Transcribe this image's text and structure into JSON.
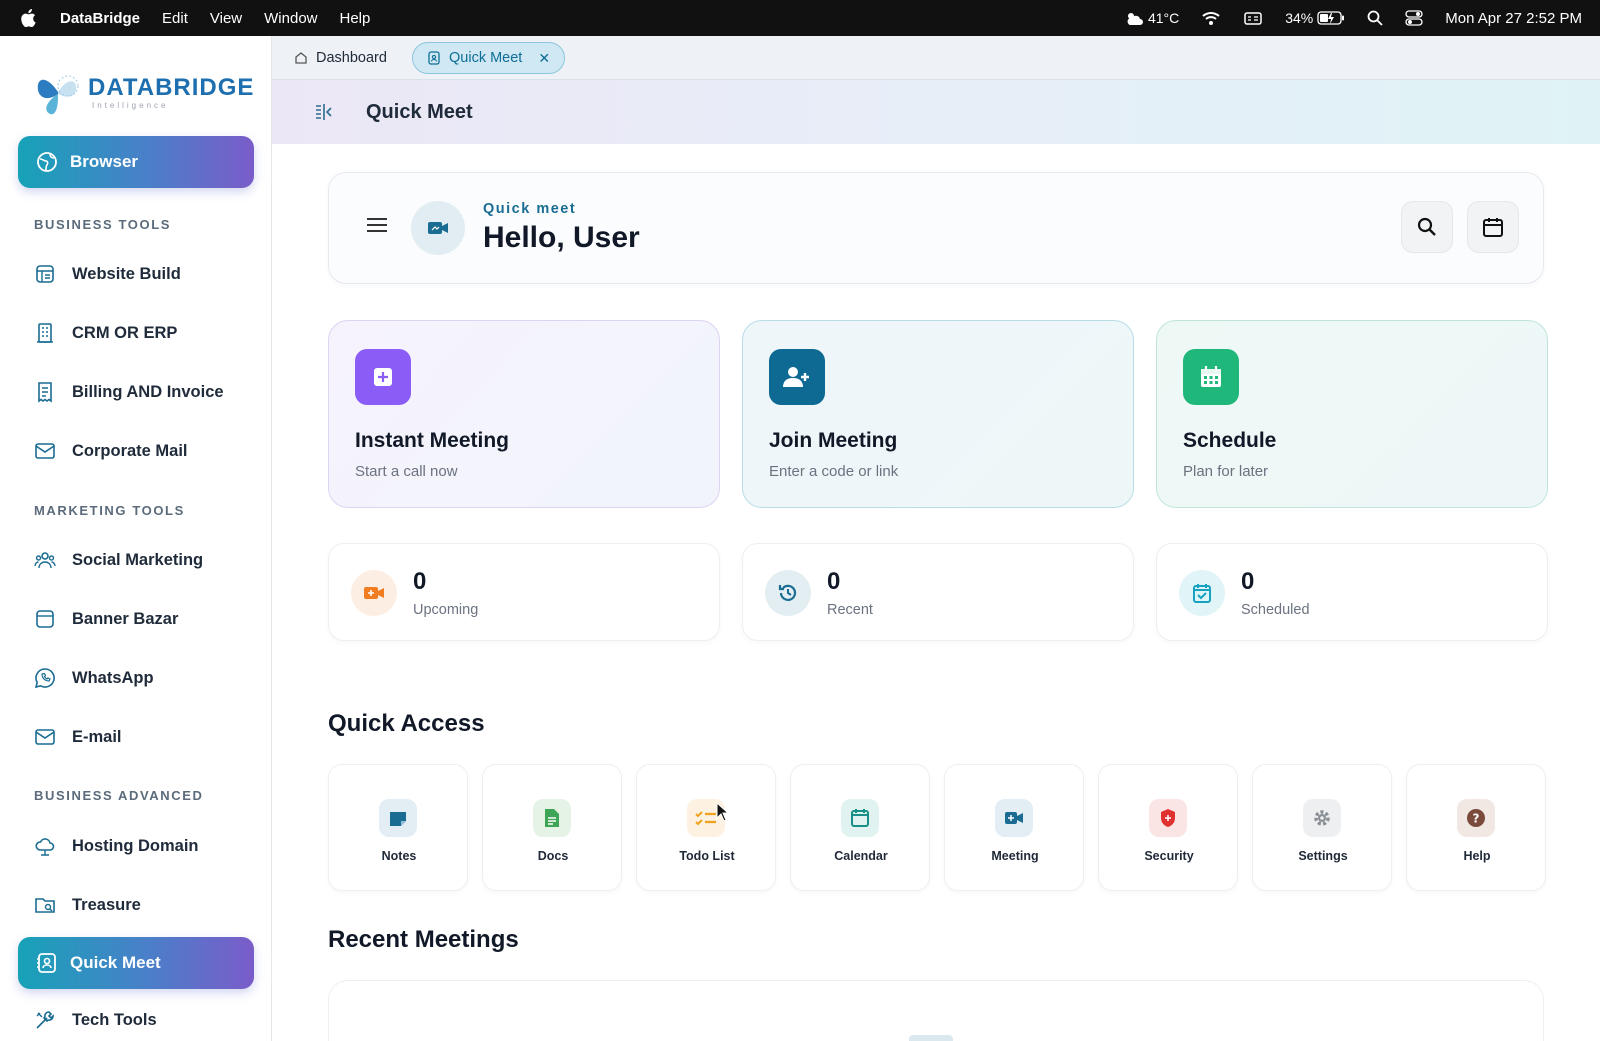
{
  "menubar": {
    "app": "DataBridge",
    "menus": [
      "Edit",
      "View",
      "Window",
      "Help"
    ],
    "weather": "41°C",
    "battery": "34%",
    "datetime": "Mon Apr 27  2:52 PM"
  },
  "sidebar": {
    "logo_main": "DATABRIDGE",
    "logo_sub": "Intelligence",
    "browser_label": "Browser",
    "sections": {
      "business_tools": "BUSINESS TOOLS",
      "marketing_tools": "MARKETING TOOLS",
      "business_advanced": "BUSINESS ADVANCED"
    },
    "items": {
      "website_build": "Website Build",
      "crm": "CRM OR ERP",
      "billing": "Billing AND  Invoice",
      "corporate_mail": "Corporate Mail",
      "social_marketing": "Social Marketing",
      "banner_bazar": "Banner Bazar",
      "whatsapp": "WhatsApp",
      "email": "E-mail",
      "hosting_domain": "Hosting Domain",
      "treasure": "Treasure",
      "quick_meet": "Quick Meet",
      "tech_tools": "Tech Tools"
    }
  },
  "tabs": {
    "dashboard": "Dashboard",
    "quick_meet": "Quick Meet"
  },
  "header": {
    "title": "Quick Meet"
  },
  "hello": {
    "subtitle": "Quick meet",
    "title": "Hello, User"
  },
  "actions": [
    {
      "title": "Instant Meeting",
      "subtitle": "Start a call now",
      "icon": "plus-icon"
    },
    {
      "title": "Join Meeting",
      "subtitle": "Enter a code or link",
      "icon": "add-user-icon"
    },
    {
      "title": "Schedule",
      "subtitle": "Plan for later",
      "icon": "calendar-icon"
    }
  ],
  "stats": [
    {
      "value": "0",
      "label": "Upcoming",
      "icon": "video-icon"
    },
    {
      "value": "0",
      "label": "Recent",
      "icon": "history-icon"
    },
    {
      "value": "0",
      "label": "Scheduled",
      "icon": "calendar-check-icon"
    }
  ],
  "quick_access": {
    "title": "Quick Access",
    "items": [
      "Notes",
      "Docs",
      "Todo List",
      "Calendar",
      "Meeting",
      "Security",
      "Settings",
      "Help"
    ]
  },
  "recent_meetings": {
    "title": "Recent Meetings"
  },
  "colors": {
    "accent_teal": "#17a2b8",
    "accent_purple": "#7b5cc9",
    "instant": "#8b5cf6",
    "join": "#0e6a93",
    "schedule": "#1fb87a"
  }
}
